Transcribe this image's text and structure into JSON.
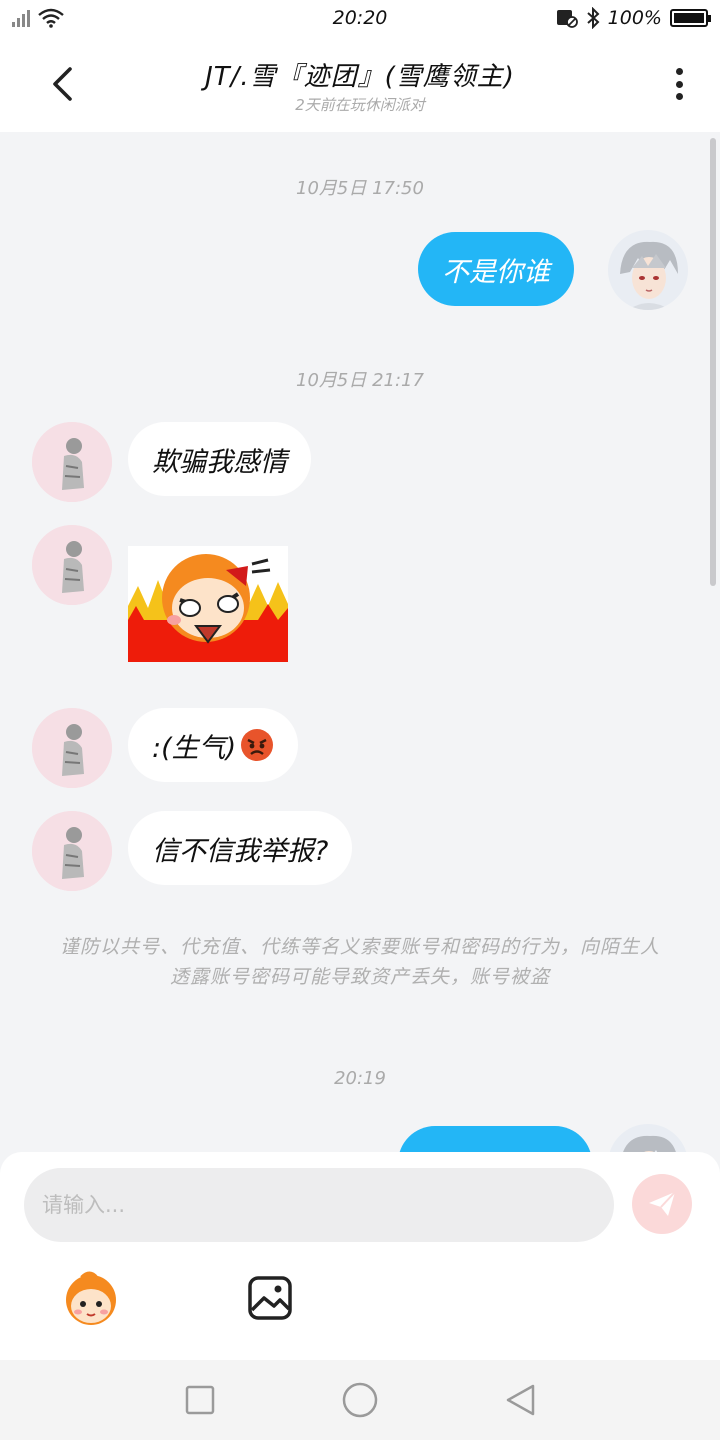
{
  "status": {
    "time": "20:20",
    "battery": "100%"
  },
  "header": {
    "title": "JT/.雪『迹团』(雪鹰领主)",
    "subtitle": "2天前在玩休闲派对"
  },
  "chat": {
    "timestamps": [
      "10月5日 17:50",
      "10月5日 21:17",
      "20:19"
    ],
    "messages": {
      "m1": "不是你谁",
      "m2": "欺骗我感情",
      "m4": ":(生气)",
      "m5": "信不信我举报?"
    },
    "notice": "谨防以共号、代充值、代练等名义索要账号和密码的行为，向陌生人透露账号密码可能导致资产丢失，账号被盗"
  },
  "input": {
    "placeholder": "请输入..."
  },
  "colors": {
    "accent": "#23b6f6",
    "send_disabled": "#fbd9d9",
    "background": "#f3f4f6"
  },
  "icons": {
    "back": "chevron-left-icon",
    "more": "more-vertical-icon",
    "send": "paper-plane-icon",
    "sticker": "sticker-face-icon",
    "image": "image-icon",
    "nav": [
      "square-icon",
      "circle-icon",
      "triangle-back-icon"
    ]
  }
}
